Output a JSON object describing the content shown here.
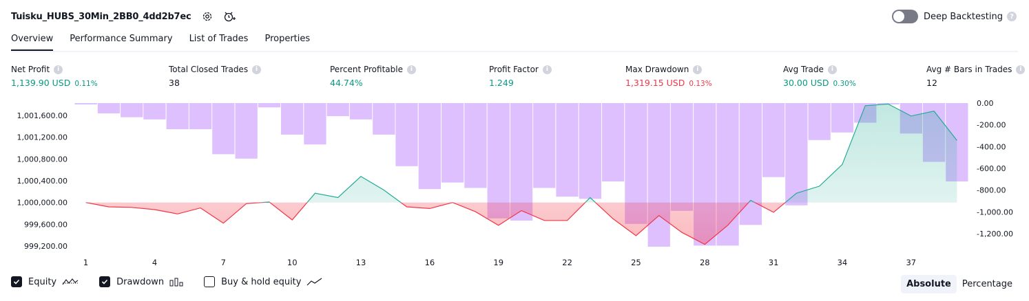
{
  "header": {
    "strategy_name": "Tuisku_HUBS_30Min_2BB0_4dd2b7ec",
    "settings_icon": "gear-icon",
    "alert_icon": "alarm-clock-plus-icon"
  },
  "deep_backtesting": {
    "label": "Deep Backtesting",
    "enabled": false
  },
  "tabs": [
    {
      "label": "Overview",
      "active": true
    },
    {
      "label": "Performance Summary",
      "active": false
    },
    {
      "label": "List of Trades",
      "active": false
    },
    {
      "label": "Properties",
      "active": false
    }
  ],
  "metrics": [
    {
      "label": "Net Profit",
      "value": "1,139.90 USD",
      "pct": "0.11%",
      "tone": "pos"
    },
    {
      "label": "Total Closed Trades",
      "value": "38",
      "pct": "",
      "tone": "neutral"
    },
    {
      "label": "Percent Profitable",
      "value": "44.74%",
      "pct": "",
      "tone": "pos"
    },
    {
      "label": "Profit Factor",
      "value": "1.249",
      "pct": "",
      "tone": "pos"
    },
    {
      "label": "Max Drawdown",
      "value": "1,319.15 USD",
      "pct": "0.13%",
      "tone": "neg"
    },
    {
      "label": "Avg Trade",
      "value": "30.00 USD",
      "pct": "0.30%",
      "tone": "pos"
    },
    {
      "label": "Avg # Bars in Trades",
      "value": "12",
      "pct": "",
      "tone": "neutral"
    }
  ],
  "colors": {
    "positive": "#089981",
    "negative": "#f23645",
    "equity_up": "#22ab94",
    "equity_down": "#f23645",
    "drawdown_bar": "#d6b0ff",
    "text": "#131722"
  },
  "chart_data": {
    "type": "line",
    "x": [
      1,
      2,
      3,
      4,
      5,
      6,
      7,
      8,
      9,
      10,
      11,
      12,
      13,
      14,
      15,
      16,
      17,
      18,
      19,
      20,
      21,
      22,
      23,
      24,
      25,
      26,
      27,
      28,
      29,
      30,
      31,
      32,
      33,
      34,
      35,
      36,
      37,
      38,
      39
    ],
    "x_tick_labels": [
      "1",
      "4",
      "7",
      "10",
      "13",
      "16",
      "19",
      "22",
      "25",
      "28",
      "31",
      "34",
      "37"
    ],
    "equity_baseline": 1000000,
    "series": [
      {
        "name": "Equity",
        "axis": "left",
        "values": [
          1000000,
          999920,
          999910,
          999870,
          999790,
          999900,
          999620,
          999980,
          1000010,
          999680,
          1000170,
          1000090,
          1000480,
          1000230,
          999920,
          999890,
          1000000,
          999830,
          999580,
          999850,
          999670,
          999670,
          1000090,
          999700,
          999390,
          999760,
          999450,
          999230,
          999580,
          1000040,
          999820,
          1000170,
          1000300,
          1000700,
          1001780,
          1001810,
          1001590,
          1001680,
          1001140
        ]
      },
      {
        "name": "Drawdown",
        "axis": "right",
        "type": "bar",
        "values": [
          0,
          -95,
          -130,
          -150,
          -240,
          -240,
          -470,
          -510,
          -40,
          -290,
          -380,
          -120,
          -150,
          -290,
          -580,
          -790,
          -730,
          -780,
          -1060,
          -1080,
          -780,
          -860,
          -880,
          -720,
          -1110,
          -1320,
          -990,
          -1310,
          -1310,
          -1120,
          -680,
          -940,
          -340,
          -270,
          -180,
          0,
          -280,
          -540,
          -720
        ]
      }
    ],
    "left_axis": {
      "ticks": [
        "1,001,600.00",
        "1,001,200.00",
        "1,000,800.00",
        "1,000,400.00",
        "1,000,000.00",
        "999,600.00",
        "999,200.00"
      ],
      "range": [
        999000,
        1001850
      ]
    },
    "right_axis": {
      "ticks": [
        "0.00",
        "-200.00",
        "-400.00",
        "-600.00",
        "-800.00",
        "-1,000.00",
        "-1,200.00"
      ],
      "range": [
        -1455,
        10
      ]
    }
  },
  "legend": [
    {
      "label": "Equity",
      "checked": true,
      "icon": "equity-line-icon"
    },
    {
      "label": "Drawdown",
      "checked": true,
      "icon": "drawdown-bars-icon"
    },
    {
      "label": "Buy & hold equity",
      "checked": false,
      "icon": "buy-hold-line-icon"
    }
  ],
  "view_mode": {
    "options": [
      "Absolute",
      "Percentage"
    ],
    "selected": "Absolute"
  }
}
